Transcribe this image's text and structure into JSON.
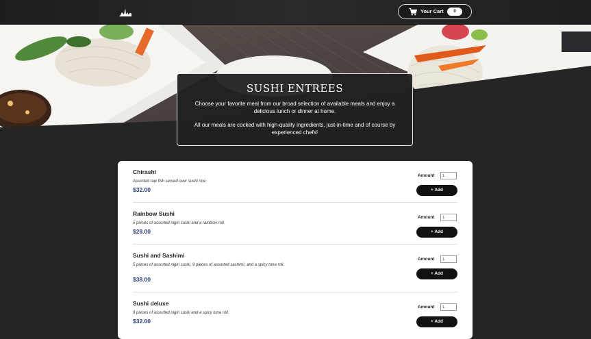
{
  "header": {
    "cart_label": "Your Cart",
    "cart_count": "0"
  },
  "intro": {
    "title": "SUSHI ENTREES",
    "paragraph1": "Choose your favorite meal from our broad selection of available meals and enjoy a delicious lunch or dinner at home.",
    "paragraph2": "All our meals are cocked with high-quality ingredients, just-in-time and of course by experienced chefs!"
  },
  "meals": {
    "amount_label": "Amount",
    "add_label": "+ Add",
    "items": [
      {
        "name": "Chirashi",
        "description": "Assorted raw fish served over sushi rice.",
        "price": "$32.00",
        "amount": "1"
      },
      {
        "name": "Rainbow Sushi",
        "description": "5 pieces of assorted nigiri sushi and a rainbow roll.",
        "price": "$28.00",
        "amount": "1"
      },
      {
        "name": "Sushi and Sashimi",
        "description": "5 pieces of assorted nigiri sushi, 9 pieces of assorted sashimi, and a spicy tuna roll.",
        "price": "$38.00",
        "amount": "1"
      },
      {
        "name": "Sushi deluxe",
        "description": "9 pieces of assorted nigiri sushi and a spicy tuna roll.",
        "price": "$32.00",
        "amount": "1"
      }
    ]
  },
  "colors": {
    "background": "#252525",
    "price": "#2c3e7a",
    "button": "#111111"
  }
}
